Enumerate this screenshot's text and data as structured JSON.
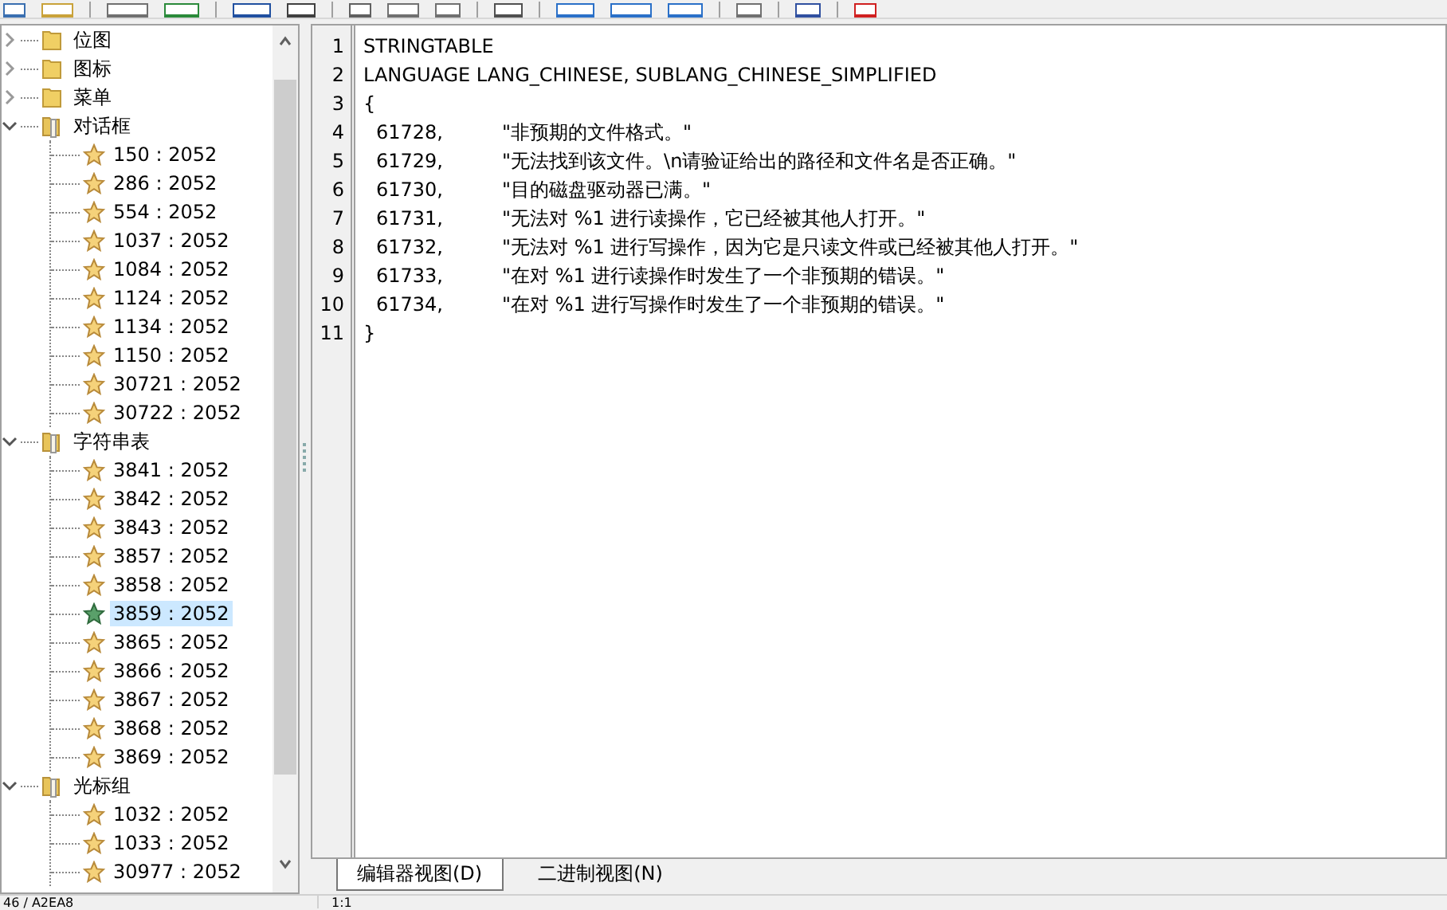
{
  "tree": [
    {
      "label": "位图",
      "expanded": false,
      "selected": false
    },
    {
      "label": "图标",
      "expanded": false,
      "selected": false
    },
    {
      "label": "菜单",
      "expanded": false,
      "selected": false
    },
    {
      "label": "对话框",
      "expanded": true,
      "selected": false,
      "children": [
        {
          "label": "150 : 2052",
          "selected": false
        },
        {
          "label": "286 : 2052",
          "selected": false
        },
        {
          "label": "554 : 2052",
          "selected": false
        },
        {
          "label": "1037 : 2052",
          "selected": false
        },
        {
          "label": "1084 : 2052",
          "selected": false
        },
        {
          "label": "1124 : 2052",
          "selected": false
        },
        {
          "label": "1134 : 2052",
          "selected": false
        },
        {
          "label": "1150 : 2052",
          "selected": false
        },
        {
          "label": "30721 : 2052",
          "selected": false
        },
        {
          "label": "30722 : 2052",
          "selected": false
        }
      ]
    },
    {
      "label": "字符串表",
      "expanded": true,
      "selected": false,
      "children": [
        {
          "label": "3841 : 2052",
          "selected": false
        },
        {
          "label": "3842 : 2052",
          "selected": false
        },
        {
          "label": "3843 : 2052",
          "selected": false
        },
        {
          "label": "3857 : 2052",
          "selected": false
        },
        {
          "label": "3858 : 2052",
          "selected": false
        },
        {
          "label": "3859 : 2052",
          "selected": true
        },
        {
          "label": "3865 : 2052",
          "selected": false
        },
        {
          "label": "3866 : 2052",
          "selected": false
        },
        {
          "label": "3867 : 2052",
          "selected": false
        },
        {
          "label": "3868 : 2052",
          "selected": false
        },
        {
          "label": "3869 : 2052",
          "selected": false
        }
      ]
    },
    {
      "label": "光标组",
      "expanded": true,
      "selected": false,
      "children": [
        {
          "label": "1032 : 2052",
          "selected": false
        },
        {
          "label": "1033 : 2052",
          "selected": false
        },
        {
          "label": "30977 : 2052",
          "selected": false
        }
      ]
    }
  ],
  "editor": {
    "lines": [
      {
        "number": "1",
        "kind": "plain",
        "text": "STRINGTABLE"
      },
      {
        "number": "2",
        "kind": "plain",
        "text": "LANGUAGE LANG_CHINESE, SUBLANG_CHINESE_SIMPLIFIED"
      },
      {
        "number": "3",
        "kind": "plain",
        "text": "{"
      },
      {
        "number": "4",
        "kind": "entry",
        "id": "61728,",
        "string": "\"非预期的文件格式。\""
      },
      {
        "number": "5",
        "kind": "entry",
        "id": "61729,",
        "string": "\"无法找到该文件。\\n请验证给出的路径和文件名是否正确。\""
      },
      {
        "number": "6",
        "kind": "entry",
        "id": "61730,",
        "string": "\"目的磁盘驱动器已满。\""
      },
      {
        "number": "7",
        "kind": "entry",
        "id": "61731,",
        "string": "\"无法对 %1 进行读操作，它已经被其他人打开。\""
      },
      {
        "number": "8",
        "kind": "entry",
        "id": "61732,",
        "string": "\"无法对 %1 进行写操作，因为它是只读文件或已经被其他人打开。\""
      },
      {
        "number": "9",
        "kind": "entry",
        "id": "61733,",
        "string": "\"在对 %1 进行读操作时发生了一个非预期的错误。\""
      },
      {
        "number": "10",
        "kind": "entry",
        "id": "61734,",
        "string": "\"在对 %1 进行写操作时发生了一个非预期的错误。\""
      },
      {
        "number": "11",
        "kind": "plain",
        "text": "}"
      }
    ]
  },
  "view_tabs": [
    {
      "label": "编辑器视图(D)",
      "selected": true
    },
    {
      "label": "二进制视图(N)",
      "selected": false
    }
  ],
  "status_bar": [
    "46 / A2EA8",
    "1:1"
  ]
}
